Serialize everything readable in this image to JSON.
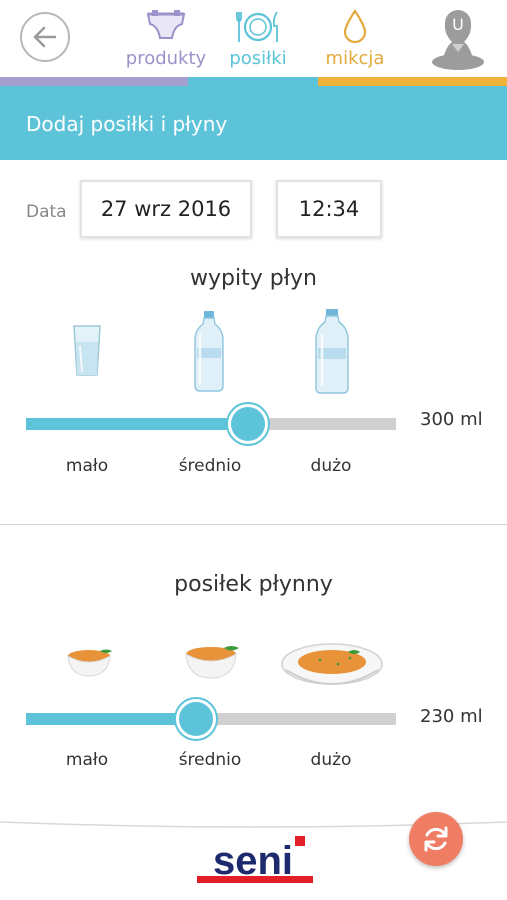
{
  "nav": {
    "tabs": [
      {
        "label": "produkty",
        "icon": "diaper-icon"
      },
      {
        "label": "posiłki",
        "icon": "plate-cutlery-icon"
      },
      {
        "label": "mikcja",
        "icon": "drop-icon"
      }
    ],
    "avatar_initial": "U",
    "colors": {
      "produkty": "#a59fd0",
      "posilki": "#5cc3d8",
      "mikcja": "#f0b33a"
    }
  },
  "header": {
    "title": "Dodaj posiłki i płyny"
  },
  "datetime": {
    "label": "Data",
    "date": "27 wrz 2016",
    "time": "12:34"
  },
  "drink": {
    "title": "wypity płyn",
    "value_text": "300 ml",
    "level": 0.6,
    "ticks": [
      "mało",
      "średnio",
      "dużo"
    ]
  },
  "meal": {
    "title": "posiłek płynny",
    "value_text": "230 ml",
    "level": 0.46,
    "ticks": [
      "mało",
      "średnio",
      "dużo"
    ]
  },
  "footer": {
    "brand": "seni"
  }
}
